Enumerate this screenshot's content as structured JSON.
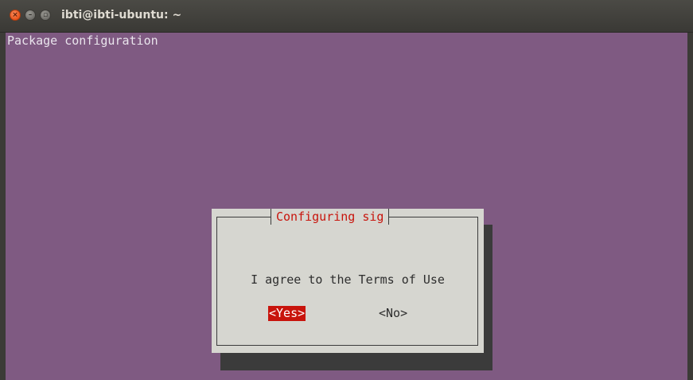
{
  "window": {
    "title": "ibti@ibti-ubuntu: ~",
    "controls": {
      "close_glyph": "×",
      "minimize_glyph": "–",
      "maximize_glyph": "▫"
    }
  },
  "terminal": {
    "header": "Package configuration",
    "background_color": "#7f5a82"
  },
  "dialog": {
    "title": "Configuring sig",
    "message": "I agree to the Terms of Use",
    "buttons": {
      "yes": "<Yes>",
      "no": "<No>"
    },
    "selected": "yes",
    "accent_color": "#c8140c"
  },
  "icons": {
    "close": "close-icon",
    "minimize": "minimize-icon",
    "maximize": "maximize-icon"
  }
}
